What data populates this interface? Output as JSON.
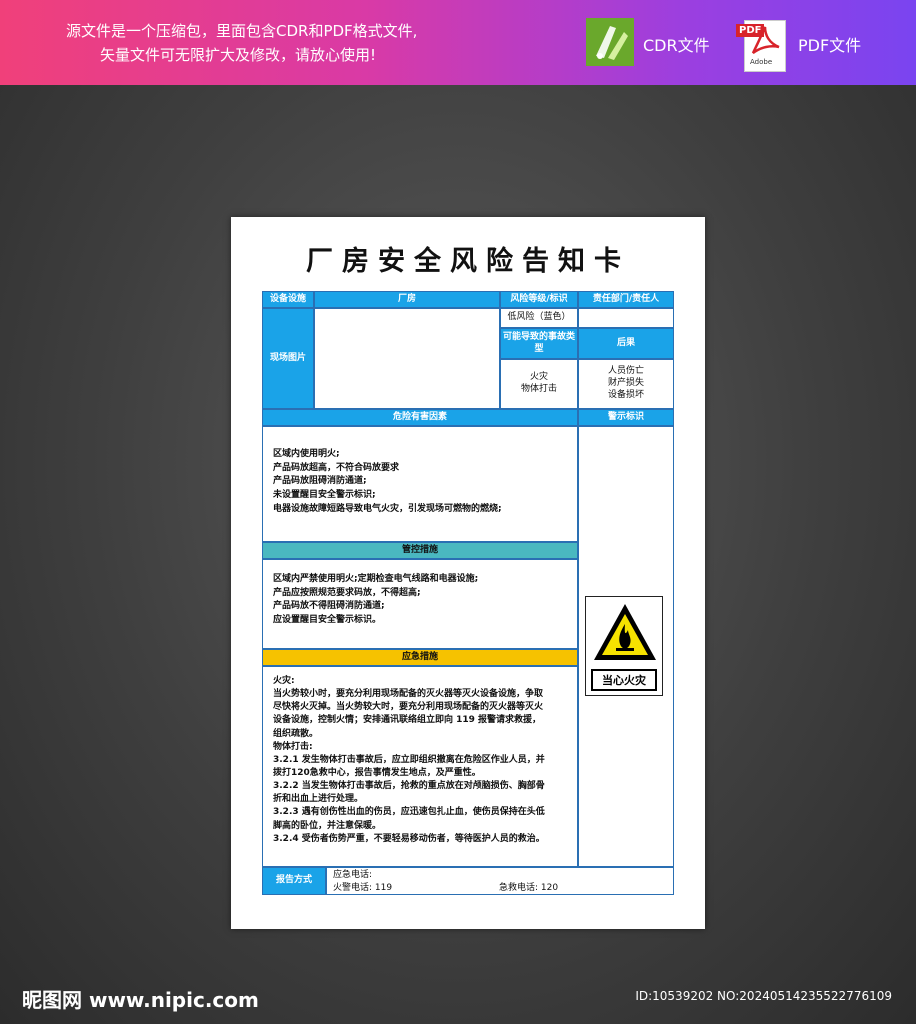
{
  "banner": {
    "line1": "源文件是一个压缩包，里面包含CDR和PDF格式文件,",
    "line2": "矢量文件可无限扩大及修改，请放心使用!",
    "cdr_label": "CDR文件",
    "pdf_label": "PDF文件",
    "pdf_tag": "PDF",
    "adobe_text": "Adobe"
  },
  "colors": {
    "header_blue": "#1aa3e8",
    "teal": "#4ab8c0",
    "yellow": "#f6c200",
    "sign_yellow": "#f6e200"
  },
  "card": {
    "title": "厂房安全风险告知卡",
    "header": {
      "device": "设备设施",
      "device_value": "厂房",
      "risk_level": "风险等级/标识",
      "responsible": "责任部门/责任人"
    },
    "site_photo": "现场图片",
    "risk_value": "低风险（蓝色）",
    "accident_type": "可能导致的事故类型",
    "consequence": "后果",
    "accidents": [
      "火灾",
      "物体打击"
    ],
    "consequences": [
      "人员伤亡",
      "财产损失",
      "设备损坏"
    ],
    "hazard_title": "危险有害因素",
    "warning_title": "警示标识",
    "hazards": [
      "区域内使用明火;",
      "产品码放超高，不符合码放要求",
      "产品码放阻碍消防通道;",
      "未设置醒目安全警示标识;",
      "电器设施故障短路导致电气火灾，引发现场可燃物的燃烧;"
    ],
    "control_title": "管控措施",
    "controls": [
      "区域内严禁使用明火;定期检查电气线路和电器设施;",
      "产品应按照规范要求码放，不得超高;",
      "产品码放不得阻碍消防通道;",
      "应设置醒目安全警示标识。"
    ],
    "emergency_title": "应急措施",
    "emergency": [
      "火灾:",
      "当火势较小时，要充分利用现场配备的灭火器等灭火设备设施，争取",
      "尽快将火灭掉。当火势较大时，要充分利用现场配备的灭火器等灭火",
      "设备设施，控制火情；安排通讯联络组立即向 119 报警请求救援，",
      "组织疏散。",
      "物体打击:",
      "3.2.1 发生物体打击事故后，应立即组织撤离在危险区作业人员，并",
      "拨打120急救中心，报告事情发生地点，及严重性。",
      "3.2.2 当发生物体打击事故后，抢救的重点放在对颅脑损伤、胸部骨",
      "折和出血上进行处理。",
      "3.2.3 遇有创伤性出血的伤员，应迅速包扎止血，使伤员保持在头低",
      "脚高的卧位，并注意保暖。",
      "3.2.4 受伤者伤势严重，不要轻易移动伤者，等待医护人员的救治。"
    ],
    "sign_text": "当心火灾",
    "report": {
      "label": "报告方式",
      "emergency_phone": "应急电话:",
      "fire_phone": "火警电话: 119",
      "ambulance_phone": "急救电话: 120"
    }
  },
  "watermark": {
    "logo": "昵图网 www.nipic.com",
    "id": "ID:10539202 NO:20240514235522776109"
  }
}
